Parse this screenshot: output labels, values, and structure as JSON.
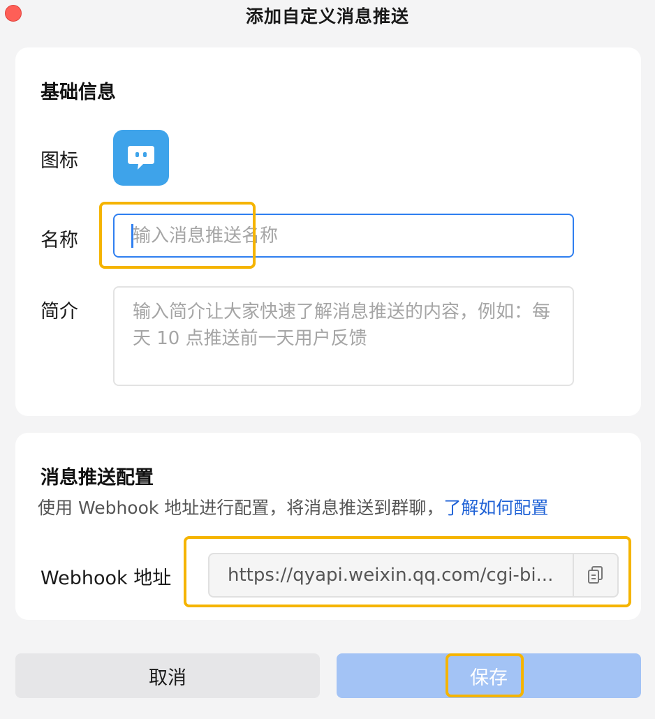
{
  "window": {
    "title": "添加自定义消息推送"
  },
  "basic": {
    "section_title": "基础信息",
    "icon_label": "图标",
    "icon": "chat-bubble-icon",
    "icon_color": "#3ea3ea",
    "name_label": "名称",
    "name_placeholder": "输入消息推送名称",
    "name_value": "",
    "intro_label": "简介",
    "intro_placeholder": "输入简介让大家快速了解消息推送的内容，例如：每天 10 点推送前一天用户反馈",
    "intro_value": ""
  },
  "push": {
    "section_title": "消息推送配置",
    "description": "使用 Webhook 地址进行配置，将消息推送到群聊，",
    "link_text": "了解如何配置",
    "webhook_label": "Webhook 地址",
    "webhook_value": "https://qyapi.weixin.qq.com/cgi-bi..."
  },
  "footer": {
    "cancel_label": "取消",
    "save_label": "保存"
  },
  "colors": {
    "primary": "#2f7ff0",
    "save_disabled": "#a3c3f5",
    "link": "#1f62d6",
    "highlight": "#f5b400"
  }
}
